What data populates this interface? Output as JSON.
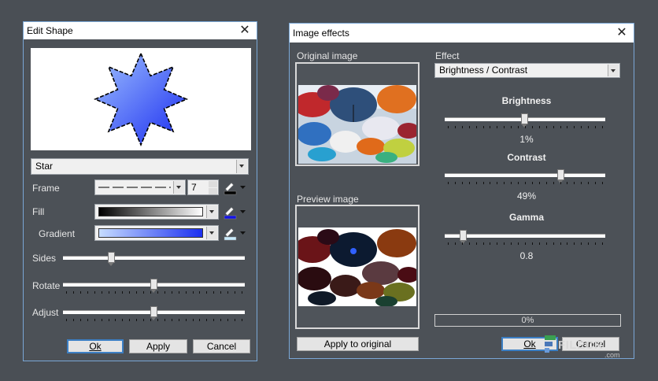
{
  "edit_shape": {
    "title": "Edit Shape",
    "shape_combo": "Star",
    "frame_label": "Frame",
    "frame_value": "7",
    "fill_label": "Fill",
    "gradient_label": "Gradient",
    "sides_label": "Sides",
    "sides_value": 0.26,
    "rotate_label": "Rotate",
    "rotate_value": 0.5,
    "adjust_label": "Adjust",
    "adjust_value": 0.5,
    "ok_label": "Ok",
    "apply_label": "Apply",
    "cancel_label": "Cancel",
    "star_gradient": [
      "#9ec0ff",
      "#1a2cf0"
    ],
    "colors": {
      "frame": "#000000",
      "fill": "#1414e6",
      "gradient": "#c8ecff"
    }
  },
  "image_effects": {
    "title": "Image effects",
    "original_label": "Original image",
    "preview_label": "Preview image",
    "effect_label": "Effect",
    "effect_value": "Brightness / Contrast",
    "brightness_label": "Brightness",
    "brightness_value_text": "1%",
    "brightness_value": 0.5,
    "contrast_label": "Contrast",
    "contrast_value_text": "49%",
    "contrast_value": 0.735,
    "gamma_label": "Gamma",
    "gamma_value_text": "0.8",
    "gamma_value": 0.1,
    "progress_text": "0%",
    "progress_value": 0,
    "apply_original_label": "Apply to original",
    "ok_label": "Ok",
    "cancel_label": "Cancel"
  },
  "watermark": {
    "brand": "FILECR",
    "suffix": ".com"
  }
}
